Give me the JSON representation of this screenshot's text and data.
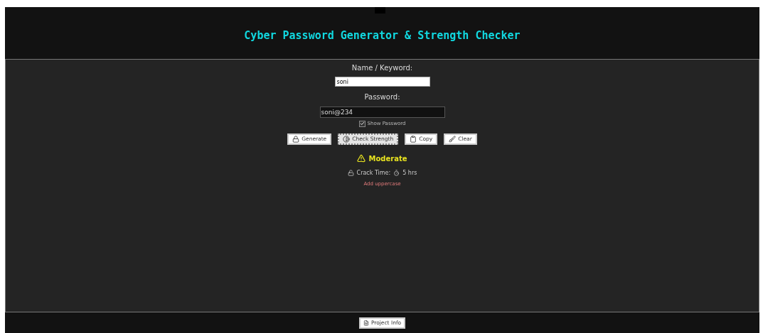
{
  "title": "Cyber Password Generator & Strength Checker",
  "name_field": {
    "label": "Name / Keyword:",
    "value": "soni"
  },
  "password_field": {
    "label": "Password:",
    "value": "soni@234"
  },
  "show_password": {
    "label": "Show Password",
    "checked": true
  },
  "buttons": [
    {
      "kind": "generate",
      "label": "Generate",
      "focused": false
    },
    {
      "kind": "check",
      "label": "Check Strength",
      "focused": true
    },
    {
      "kind": "copy",
      "label": "Copy",
      "focused": false
    },
    {
      "kind": "clear",
      "label": "Clear",
      "focused": false
    }
  ],
  "result": {
    "strength": "Moderate",
    "crack_label": "Crack Time:",
    "crack_time": "5 hrs",
    "suggestion": "Add uppercase"
  },
  "footer_button": "Project Info"
}
